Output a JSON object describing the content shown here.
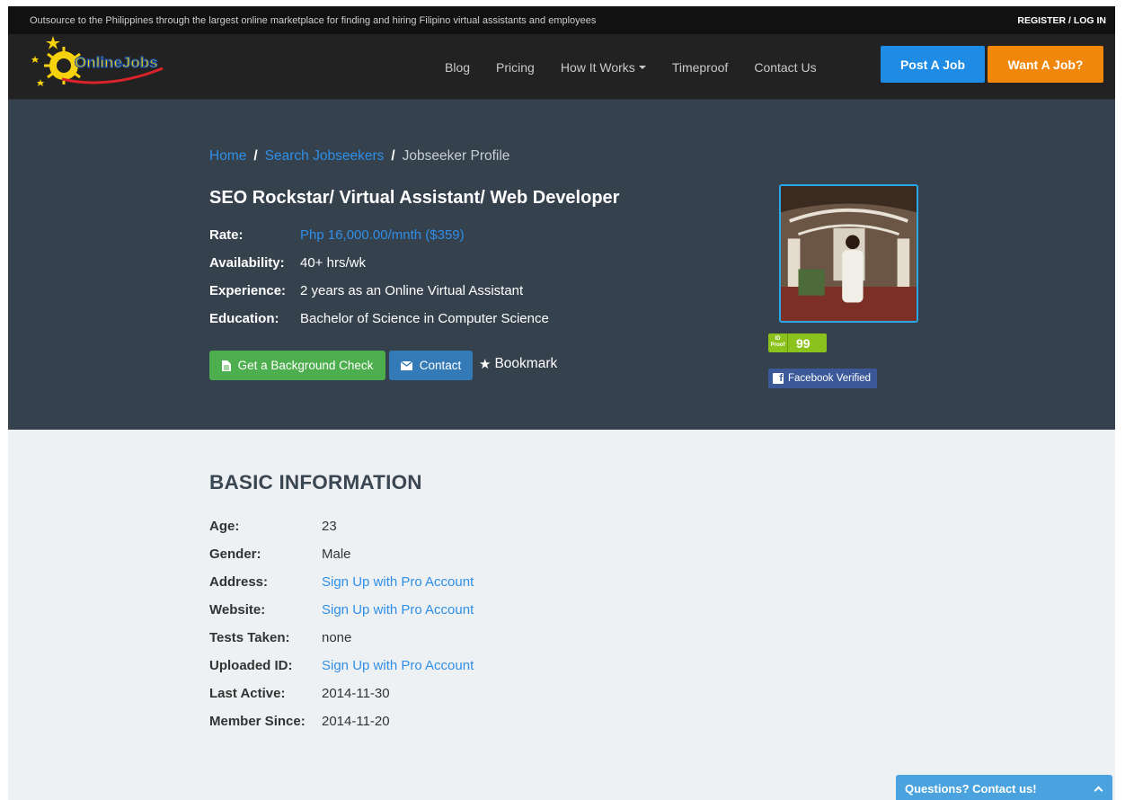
{
  "topbar": {
    "tagline": "Outsource to the Philippines through the largest online marketplace for finding and hiring Filipino virtual assistants and employees",
    "login": "REGISTER / LOG IN"
  },
  "nav": {
    "logo_text": "OnlineJobs",
    "links": [
      "Blog",
      "Pricing",
      "How It Works",
      "Timeproof",
      "Contact Us"
    ],
    "post_job": "Post A Job",
    "want_job": "Want A Job?"
  },
  "breadcrumb": {
    "home": "Home",
    "search": "Search Jobseekers",
    "current": "Jobseeker Profile",
    "separator": "/"
  },
  "profile": {
    "title": "SEO Rockstar/ Virtual Assistant/ Web Developer",
    "rate_label": "Rate:",
    "rate_value": "Php 16,000.00/mnth ($359)",
    "availability_label": "Availability:",
    "availability_value": "40+ hrs/wk",
    "experience_label": "Experience:",
    "experience_value": "2 years as an Online Virtual Assistant",
    "education_label": "Education:",
    "education_value": "Bachelor of Science in Computer Science",
    "bg_check": "Get a Background Check",
    "contact": "Contact",
    "bookmark": "Bookmark",
    "id_proof_label": "ID Proof",
    "id_proof_score": "99",
    "facebook": "Facebook Verified"
  },
  "basic": {
    "heading": "BASIC INFORMATION",
    "rows": [
      {
        "label": "Age:",
        "value": "23"
      },
      {
        "label": "Gender:",
        "value": "Male"
      },
      {
        "label": "Address:",
        "value": "Sign Up with Pro Account"
      },
      {
        "label": "Website:",
        "value": "Sign Up with Pro Account"
      },
      {
        "label": "Tests Taken:",
        "value": "none"
      },
      {
        "label": "Uploaded ID:",
        "value": "Sign Up with Pro Account"
      },
      {
        "label": "Last Active:",
        "value": "2014-11-30"
      },
      {
        "label": "Member Since:",
        "value": "2014-11-20"
      }
    ]
  },
  "chat": {
    "label": "Questions? Contact us!"
  },
  "colors": {
    "hero_bg": "#35414c",
    "link": "#2f8fe8",
    "post_job": "#1e8be5",
    "want_job": "#f0870a",
    "bg_check": "#4cae4c",
    "contact": "#337ab7"
  }
}
